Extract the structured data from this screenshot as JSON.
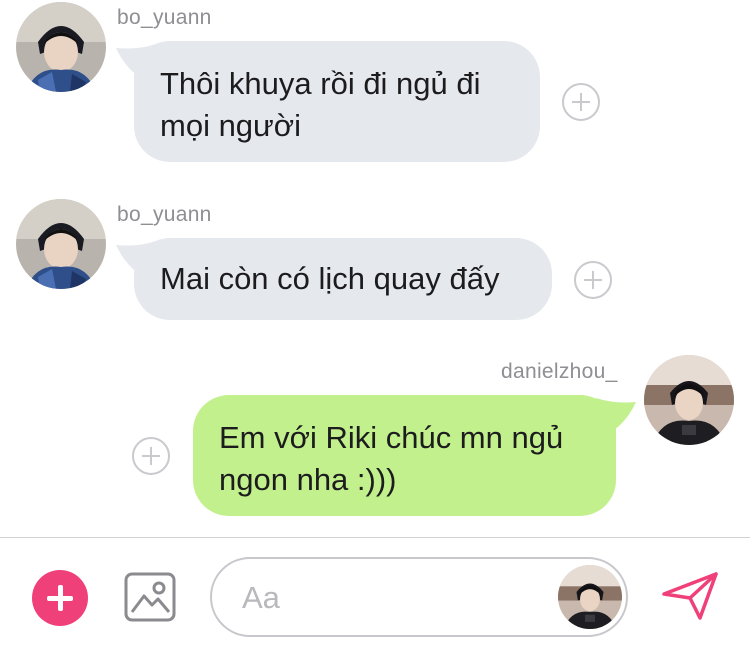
{
  "messages": [
    {
      "sender": "bo_yuann",
      "direction": "incoming",
      "lines": [
        "Thôi khuya rồi đi ngủ đi",
        "mọi người"
      ]
    },
    {
      "sender": "bo_yuann",
      "direction": "incoming",
      "lines": [
        "Mai còn có lịch quay đấy"
      ]
    },
    {
      "sender": "danielzhou_",
      "direction": "outgoing",
      "lines": [
        "Em với Riki chúc mn ngủ",
        "ngon nha :)))"
      ]
    }
  ],
  "composer": {
    "placeholder": "Aa",
    "icons": [
      "plus-icon",
      "image-icon",
      "send-icon"
    ]
  },
  "colors": {
    "incoming_bubble": "#e5e8ec",
    "outgoing_bubble": "#c2f08c",
    "accent_pink": "#f0407a",
    "username_gray": "#8e8e93"
  }
}
